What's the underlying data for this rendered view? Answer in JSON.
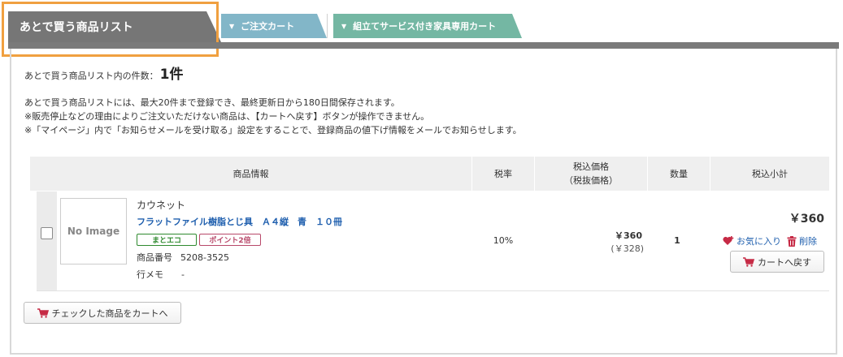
{
  "tabs": {
    "active_label": "あとで買う商品リスト",
    "cart_label": "ご注文カート",
    "furniture_label": "組立てサービス付き家具専用カート",
    "caret": "▼"
  },
  "summary": {
    "count_label": "あとで買う商品リスト内の件数：",
    "count_value": "1件"
  },
  "notices": [
    "あとで買う商品リストには、最大20件まで登録でき、最終更新日から180日間保存されます。",
    "※販売停止などの理由によりご注文いただけない商品は、【カートへ戻す】ボタンが操作できません。",
    "※「マイページ」内で「お知らせメールを受け取る」設定をすることで、登録商品の値下げ情報をメールでお知らせします。"
  ],
  "table": {
    "headers": {
      "product_info": "商品情報",
      "tax_rate": "税率",
      "price_line1": "税込価格",
      "price_line2": "（税抜価格）",
      "quantity": "数量",
      "subtotal": "税込小計"
    }
  },
  "item": {
    "image_placeholder": "No Image",
    "maker": "カウネット",
    "name": "フラットファイル樹脂とじ具　Ａ４縦　青　１０冊",
    "badges": {
      "eco": "まとエコ",
      "point": "ポイント2倍"
    },
    "product_no_label": "商品番号",
    "product_no": "5208-3525",
    "memo_label": "行メモ",
    "memo_value": "-",
    "tax_rate": "10%",
    "price": "￥360",
    "price_ex_tax": "(￥328)",
    "quantity": "1",
    "subtotal": "￥360",
    "favorite_label": "お気に入り",
    "delete_label": "削除",
    "back_to_cart_label": "カートへ戻す"
  },
  "footer": {
    "checked_to_cart_label": "チェックした商品をカートへ"
  },
  "colors": {
    "active_tab": "#767676",
    "cart_tab": "#82b6c8",
    "furniture_tab": "#74b7a3",
    "highlight": "#f0a040",
    "link": "#1f5fae",
    "icon_red": "#c62a45"
  }
}
